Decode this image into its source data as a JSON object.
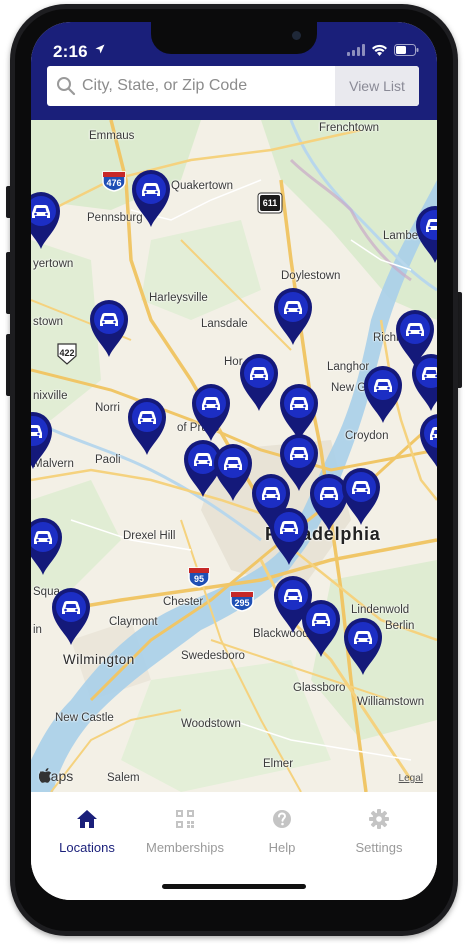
{
  "status_bar": {
    "time": "2:16",
    "location_arrow": "location-arrow-icon",
    "icons": [
      "signal-icon",
      "wifi-icon",
      "battery-icon"
    ]
  },
  "search": {
    "placeholder": "City, State, or Zip Code",
    "value": "",
    "view_list_label": "View List"
  },
  "colors": {
    "header_bg": "#1a1f7a",
    "pin_blue": "#1c2ec4",
    "pin_dark": "#14197a",
    "tab_active": "#1a1f7a",
    "tab_inactive": "#9a9a9a"
  },
  "map": {
    "labels": {
      "frenchtown": "Frenchtown",
      "emmaus": "Emmaus",
      "quakertown": "Quakertown",
      "pennsburg": "Pennsburg",
      "lambertville": "Lambertvil",
      "doylestown": "Doylestown",
      "yertown": "yertown",
      "harleysville": "Harleysville",
      "lansdale": "Lansdale",
      "stown": "stown",
      "richboro": "Richboro",
      "hor": "Hor",
      "langhorne": "Langhor",
      "newgrove": "New Grove",
      "nixville": "nixville",
      "norri": "Norri",
      "ofpruss": "of Pruss",
      "croydon": "Croydon",
      "b": "B",
      "malvern": "Malvern",
      "paoli": "Paoli",
      "drexelhill": "Drexel Hill",
      "philadelphia": "Philadelphia",
      "chester": "Chester",
      "squa": "Squa",
      "claymont": "Claymont",
      "lindenwold": "Lindenwold",
      "in": "in",
      "berlin": "Berlin",
      "blackwood": "Blackwood",
      "wilmington": "Wilmington",
      "swedesboro": "Swedesboro",
      "glassboro": "Glassboro",
      "williamstown": "Williamstown",
      "newcastle": "New Castle",
      "woodstown": "Woodstown",
      "elmer": "Elmer",
      "salem": "Salem"
    },
    "shields": {
      "i476": "476",
      "us611": "611",
      "us422": "422",
      "i95": "95",
      "i295": "295"
    },
    "location_count": 26,
    "attribution_logo": "Maps",
    "legal_link": "Legal"
  },
  "tabs": [
    {
      "label": "Locations",
      "icon": "home-icon",
      "active": true
    },
    {
      "label": "Memberships",
      "icon": "qr-code-icon",
      "active": false
    },
    {
      "label": "Help",
      "icon": "help-icon",
      "active": false
    },
    {
      "label": "Settings",
      "icon": "gear-icon",
      "active": false
    }
  ]
}
